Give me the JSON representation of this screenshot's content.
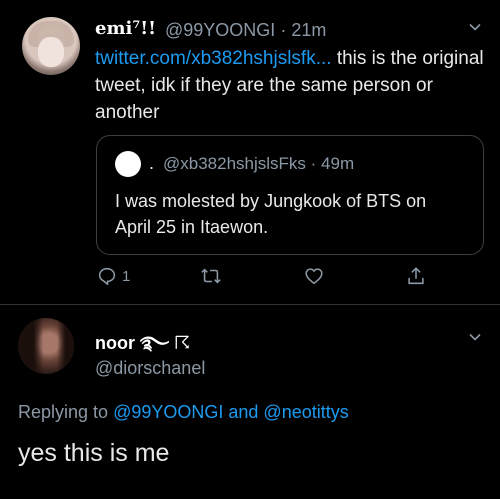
{
  "tweet": {
    "display_name": "emi⁷!!",
    "handle": "@99YOONGI",
    "time": "· 21m",
    "link_text": "twitter.com/xb382hshjslsfk...",
    "text": " this is the original tweet, idk if they are the same person or another",
    "quote": {
      "separator": ".",
      "handle": "@xb382hshjslsFks · 49m",
      "text": "I was molested by Jungkook of BTS on April 25 in Itaewon."
    },
    "actions": {
      "reply_count": "1"
    }
  },
  "reply": {
    "display_name": "noor ࿐ ☈",
    "handle": "@diorschanel",
    "replying_prefix": "Replying to ",
    "mention_1": "@99YOONGI",
    "and_text": " and ",
    "mention_2": "@neotittys",
    "text": "yes this is me"
  },
  "colors": {
    "background": "#000000",
    "link": "#1d9bf0",
    "secondary": "#8b98a5",
    "primary_text": "#e7e9ea"
  },
  "icons": [
    "chevron-down-icon",
    "reply-icon",
    "retweet-icon",
    "like-icon",
    "share-icon"
  ]
}
